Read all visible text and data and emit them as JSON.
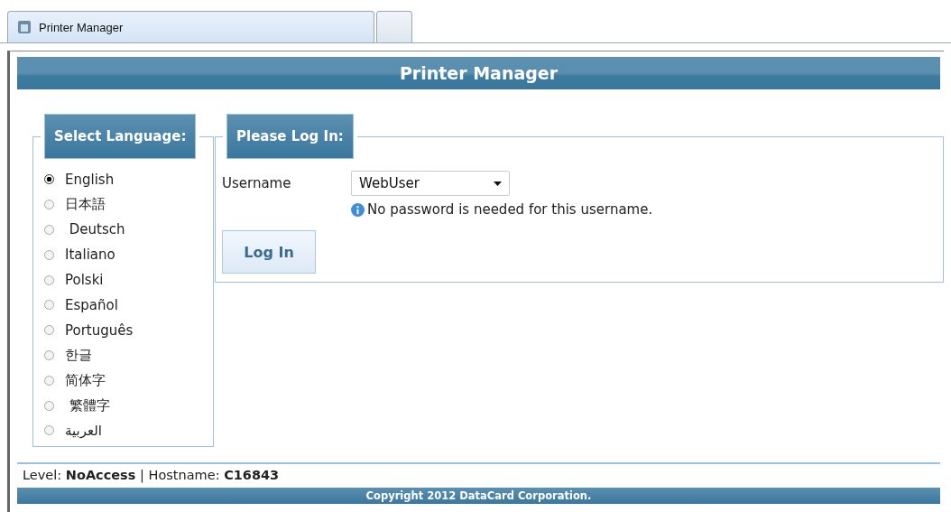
{
  "browser_tabs": [
    {
      "title": "Printer Manager",
      "selected": true
    },
    {
      "selected": false
    }
  ],
  "header": {
    "title": "Printer Manager"
  },
  "language_panel": {
    "legend": "Select Language:",
    "languages": [
      {
        "label": "English",
        "selected": true
      },
      {
        "label": "日本語",
        "selected": false
      },
      {
        "label": " Deutsch",
        "selected": false
      },
      {
        "label": "Italiano",
        "selected": false
      },
      {
        "label": "Polski",
        "selected": false
      },
      {
        "label": "Español",
        "selected": false
      },
      {
        "label": "Português",
        "selected": false
      },
      {
        "label": "한글",
        "selected": false
      },
      {
        "label": "简体字",
        "selected": false
      },
      {
        "label": " 繁體字",
        "selected": false
      },
      {
        "label": "العربية",
        "selected": false
      }
    ]
  },
  "login_panel": {
    "legend": "Please Log In:",
    "username_label": "Username",
    "username_value": "WebUser",
    "info": "No password is needed for this username.",
    "button": "Log In"
  },
  "status_line": "Level: **NoAccess** | Hostname: **C16843**",
  "footer": "Copyright 2012 DataCard Corporation."
}
